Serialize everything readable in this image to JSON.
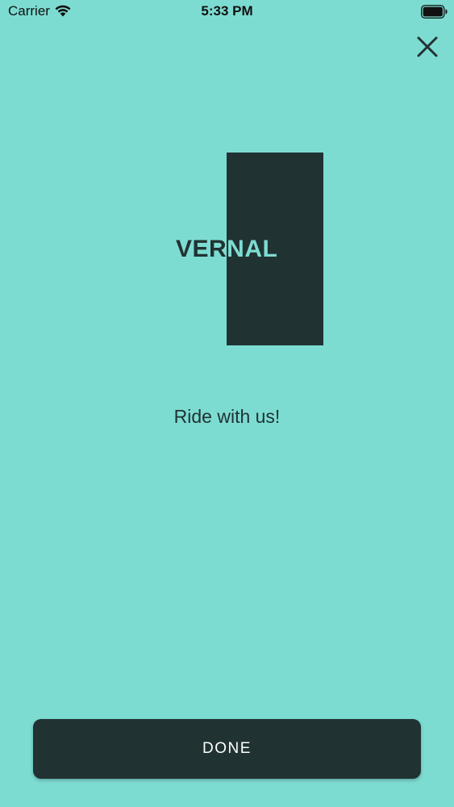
{
  "status_bar": {
    "carrier": "Carrier",
    "time": "5:33 PM",
    "wifi_icon": "wifi-icon",
    "battery_icon": "battery-icon"
  },
  "header": {
    "close_icon": "close-icon"
  },
  "logo": {
    "text": "VERNAL"
  },
  "main": {
    "tagline": "Ride with us!"
  },
  "footer": {
    "done_label": "DONE"
  },
  "colors": {
    "background": "#7ddcd2",
    "dark": "#213233",
    "button_text": "#ffffff"
  }
}
